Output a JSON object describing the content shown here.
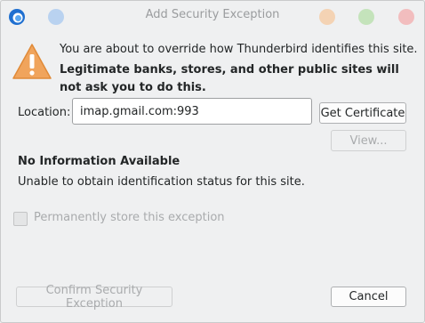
{
  "window": {
    "title": "Add Security Exception",
    "controls": [
      "minimize",
      "maximize",
      "close"
    ],
    "control_colors": {
      "minimize": "#f4c9a6",
      "maximize": "#b9e0b0",
      "close": "#f0b1b3"
    }
  },
  "warning": {
    "icon": "warning-triangle-icon",
    "line1": "You are about to override how Thunderbird identifies this site.",
    "line2": "Legitimate banks, stores, and other public sites will not ask you to do this."
  },
  "location": {
    "label": "Location:",
    "value": "imap.gmail.com:993",
    "get_certificate": "Get Certificate",
    "view": "View..."
  },
  "info": {
    "heading": "No Information Available",
    "description": "Unable to obtain identification status for this site."
  },
  "permanent": {
    "label": "Permanently store this exception",
    "checked": false
  },
  "buttons": {
    "confirm": "Confirm Security Exception",
    "cancel": "Cancel"
  }
}
